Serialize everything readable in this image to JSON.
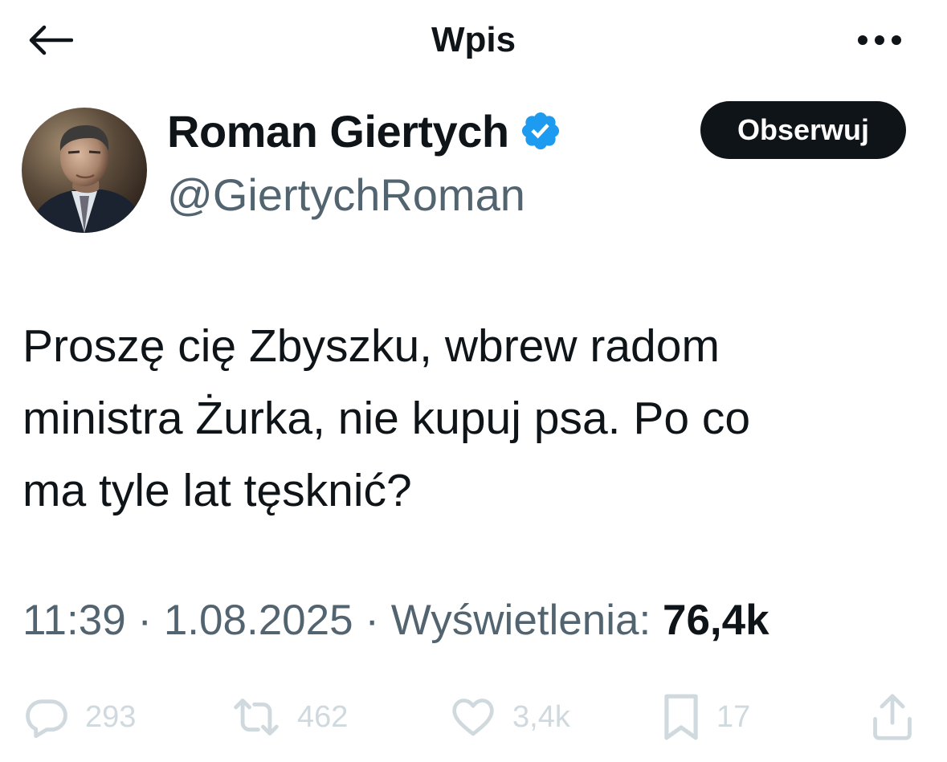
{
  "header": {
    "back_icon": "arrow-left-icon",
    "title": "Wpis",
    "more_icon": "more-horizontal-icon"
  },
  "author": {
    "display_name": "Roman Giertych",
    "verified_icon": "verified-badge-icon",
    "verified_color": "#1d9bf0",
    "handle": "@GiertychRoman",
    "follow_label": "Obserwuj"
  },
  "tweet": {
    "lines": [
      "Proszę cię Zbyszku, wbrew radom",
      "ministra Żurka, nie kupuj psa. Po co",
      "ma tyle lat tęsknić?"
    ]
  },
  "meta": {
    "time": "11:39",
    "sep1": " · ",
    "date": "1.08.2025",
    "sep2": " · ",
    "views_label": "Wyświetlenia: ",
    "views_count": "76,4k"
  },
  "actions": {
    "replies": {
      "icon": "reply-icon",
      "count": "293"
    },
    "reposts": {
      "icon": "repost-icon",
      "count": "462"
    },
    "likes": {
      "icon": "heart-icon",
      "count": "3,4k"
    },
    "bookmarks": {
      "icon": "bookmark-icon",
      "count": "17"
    },
    "share": {
      "icon": "share-icon"
    }
  },
  "colors": {
    "text": "#0f1419",
    "secondary": "#536471",
    "action_faded": "#cfd9de",
    "follow_bg": "#0f1419"
  }
}
